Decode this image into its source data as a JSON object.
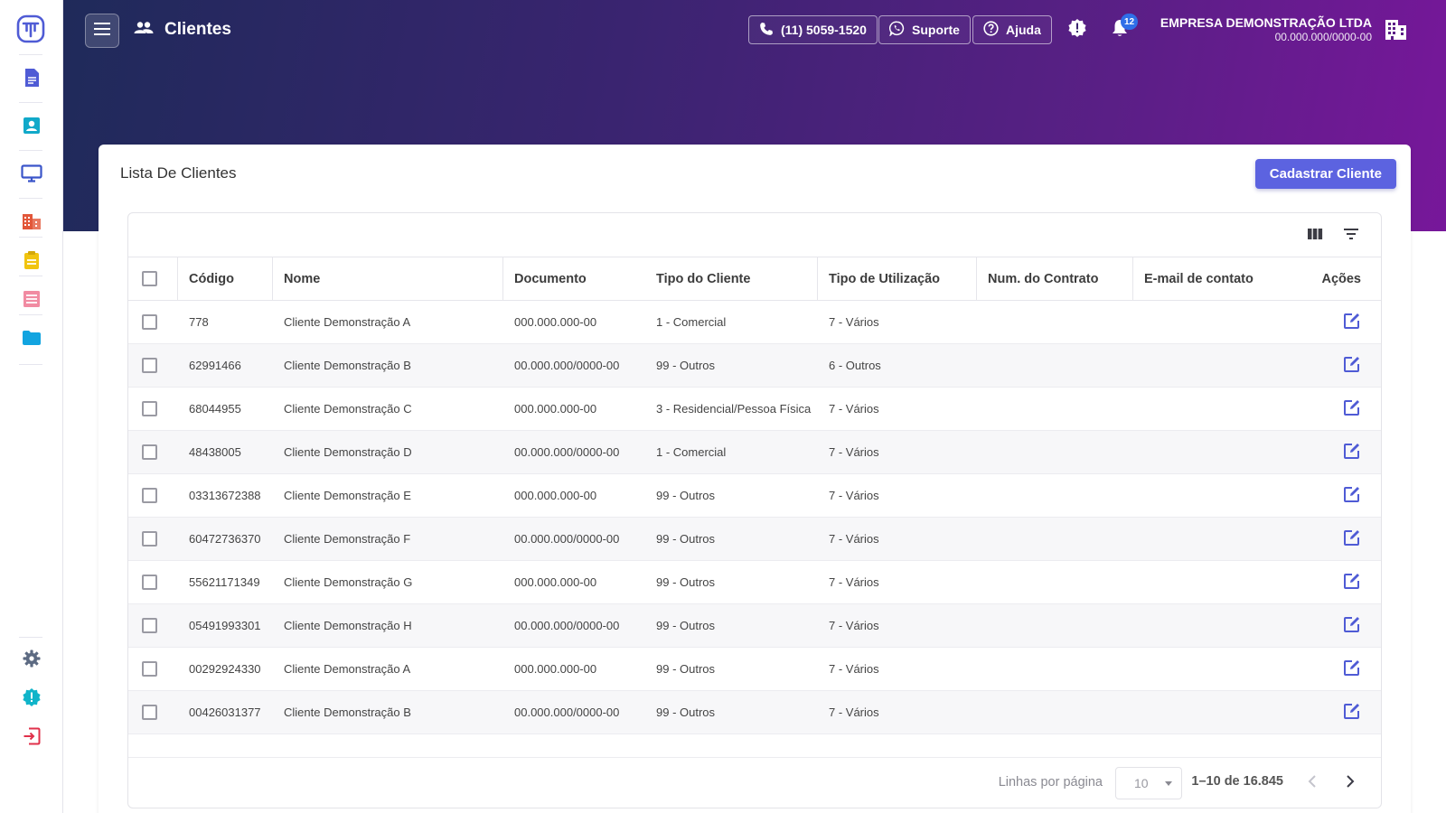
{
  "colors": {
    "accent": "#5c63e0",
    "header_gradient_start": "#1f2a5a",
    "header_gradient_end": "#77179a",
    "badge": "#2f6fe8"
  },
  "sidebar": {
    "logo_icon": "tecnospeed-logo-icon",
    "items": [
      {
        "icon": "document-icon",
        "color": "#4f5bd5"
      },
      {
        "icon": "contact-card-icon",
        "color": "#11a9c9"
      },
      {
        "icon": "monitor-icon",
        "color": "#3a55c9"
      },
      {
        "icon": "building-icon",
        "color": "#e2573a"
      },
      {
        "icon": "clipboard-icon",
        "color": "#f1c40f"
      },
      {
        "icon": "list-icon",
        "color": "#f18ba2"
      },
      {
        "icon": "folder-icon",
        "color": "#12a4e0"
      }
    ],
    "bottom": [
      {
        "icon": "gear-icon",
        "color": "#5c6a82"
      },
      {
        "icon": "alert-badge-icon",
        "color": "#10b4c9"
      },
      {
        "icon": "logout-icon",
        "color": "#e0314b"
      }
    ]
  },
  "header": {
    "title": "Clientes",
    "phone": "(11) 5059-1520",
    "support": "Suporte",
    "help": "Ajuda",
    "notification_count": "12",
    "company_name": "EMPRESA DEMONSTRAÇÃO LTDA",
    "company_doc": "00.000.000/0000-00"
  },
  "card": {
    "title": "Lista De Clientes",
    "primary_button": "Cadastrar Cliente"
  },
  "table": {
    "columns": [
      "Código",
      "Nome",
      "Documento",
      "Tipo do Cliente",
      "Tipo de Utilização",
      "Num. do Contrato",
      "E-mail de contato",
      "Ações"
    ],
    "rows": [
      {
        "codigo": "778",
        "nome": "Cliente Demonstração A",
        "documento": "000.000.000-00",
        "tipo_cliente": "1 - Comercial",
        "tipo_utilizacao": "7 - Vários",
        "contrato": "",
        "email": ""
      },
      {
        "codigo": "62991466",
        "nome": "Cliente Demonstração B",
        "documento": "00.000.000/0000-00",
        "tipo_cliente": "99 - Outros",
        "tipo_utilizacao": "6 - Outros",
        "contrato": "",
        "email": ""
      },
      {
        "codigo": "68044955",
        "nome": "Cliente Demonstração C",
        "documento": "000.000.000-00",
        "tipo_cliente": "3 - Residencial/Pessoa Física",
        "tipo_utilizacao": "7 - Vários",
        "contrato": "",
        "email": ""
      },
      {
        "codigo": "48438005",
        "nome": "Cliente Demonstração D",
        "documento": "00.000.000/0000-00",
        "tipo_cliente": "1 - Comercial",
        "tipo_utilizacao": "7 - Vários",
        "contrato": "",
        "email": ""
      },
      {
        "codigo": "03313672388",
        "nome": "Cliente Demonstração E",
        "documento": "000.000.000-00",
        "tipo_cliente": "99 - Outros",
        "tipo_utilizacao": "7 - Vários",
        "contrato": "",
        "email": ""
      },
      {
        "codigo": "60472736370",
        "nome": "Cliente Demonstração F",
        "documento": "00.000.000/0000-00",
        "tipo_cliente": "99 - Outros",
        "tipo_utilizacao": "7 - Vários",
        "contrato": "",
        "email": ""
      },
      {
        "codigo": "55621171349",
        "nome": "Cliente Demonstração G",
        "documento": "000.000.000-00",
        "tipo_cliente": "99 - Outros",
        "tipo_utilizacao": "7 - Vários",
        "contrato": "",
        "email": ""
      },
      {
        "codigo": "05491993301",
        "nome": "Cliente Demonstração H",
        "documento": "00.000.000/0000-00",
        "tipo_cliente": "99 - Outros",
        "tipo_utilizacao": "7 - Vários",
        "contrato": "",
        "email": ""
      },
      {
        "codigo": "00292924330",
        "nome": "Cliente Demonstração A",
        "documento": "000.000.000-00",
        "tipo_cliente": "99 - Outros",
        "tipo_utilizacao": "7 - Vários",
        "contrato": "",
        "email": ""
      },
      {
        "codigo": "00426031377",
        "nome": "Cliente Demonstração B",
        "documento": "00.000.000/0000-00",
        "tipo_cliente": "99 - Outros",
        "tipo_utilizacao": "7 - Vários",
        "contrato": "",
        "email": ""
      }
    ]
  },
  "pagination": {
    "rows_label": "Linhas por página",
    "rows_per_page": "10",
    "range": "1–10 de 16.845"
  }
}
